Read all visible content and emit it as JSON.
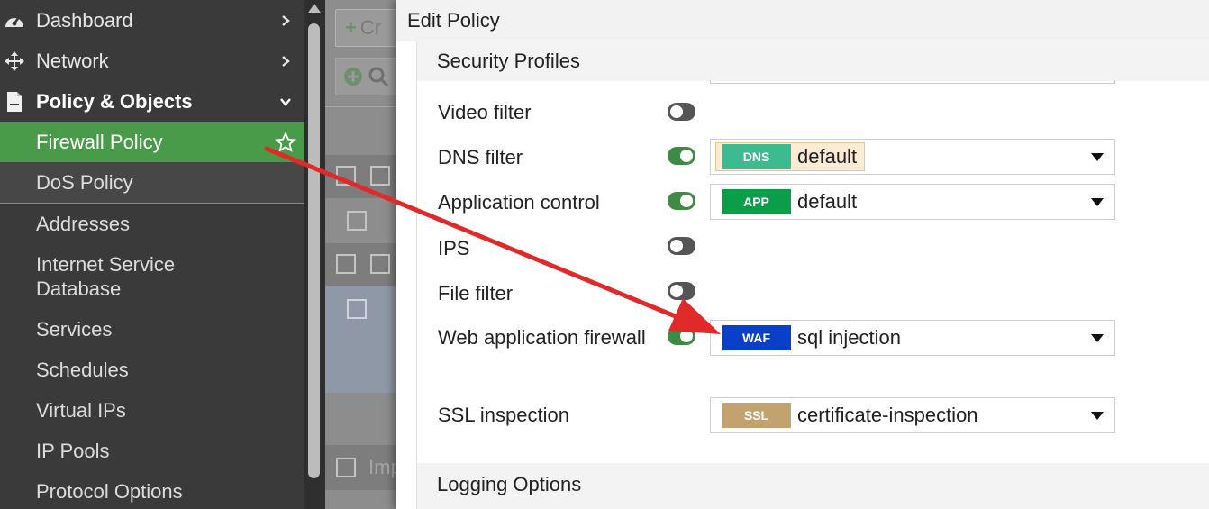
{
  "sidebar": {
    "items": [
      {
        "label": "Dashboard",
        "icon": "gauge-icon"
      },
      {
        "label": "Network",
        "icon": "move-arrows-icon"
      },
      {
        "label": "Policy & Objects",
        "icon": "document-icon"
      },
      {
        "label": "Firewall Policy",
        "icon": "star-outline-icon"
      },
      {
        "label": "DoS Policy"
      },
      {
        "label": "Addresses"
      },
      {
        "label": "Internet Service Database"
      },
      {
        "label": "Services"
      },
      {
        "label": "Schedules"
      },
      {
        "label": "Virtual IPs"
      },
      {
        "label": "IP Pools"
      },
      {
        "label": "Protocol Options"
      }
    ]
  },
  "background": {
    "create_label": "Cr",
    "import_label": "Imp"
  },
  "modal": {
    "title": "Edit Policy",
    "security_profiles": {
      "heading": "Security Profiles",
      "rows": [
        {
          "label": "Video filter",
          "enabled": false
        },
        {
          "label": "DNS filter",
          "enabled": true,
          "badge": "DNS",
          "badge_color": "#3dba8f",
          "value": "default"
        },
        {
          "label": "Application control",
          "enabled": true,
          "badge": "APP",
          "badge_color": "#0a9e48",
          "value": "default"
        },
        {
          "label": "IPS",
          "enabled": false
        },
        {
          "label": "File filter",
          "enabled": false
        },
        {
          "label": "Web application firewall",
          "enabled": true,
          "badge": "WAF",
          "badge_color": "#0a3fc8",
          "value": "sql injection"
        },
        {
          "label": "SSL inspection",
          "badge": "SSL",
          "badge_color": "#c2a370",
          "value": "certificate-inspection"
        }
      ]
    },
    "logging": {
      "heading": "Logging Options"
    }
  },
  "colors": {
    "sidebar_bg": "#3a3a3a",
    "active_item": "#4a9b49",
    "toggle_on": "#3f8a44",
    "annotation_arrow": "#e02a2a"
  }
}
